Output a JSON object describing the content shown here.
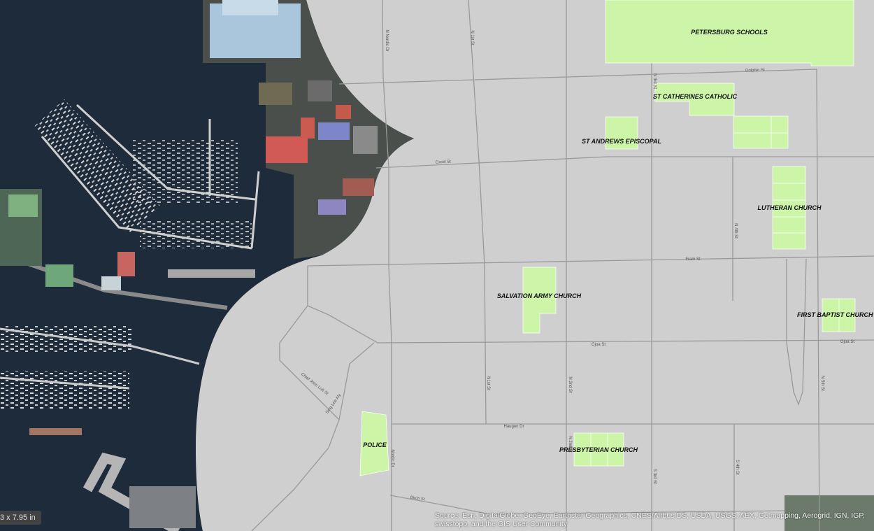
{
  "map": {
    "places": [
      {
        "id": "petersburg-schools",
        "label": "PETERSBURG SCHOOLS"
      },
      {
        "id": "st-catherines",
        "label": "ST CATHERINES CATHOLIC"
      },
      {
        "id": "st-andrews",
        "label": "ST ANDREWS EPISCOPAL"
      },
      {
        "id": "lutheran",
        "label": "LUTHERAN CHURCH"
      },
      {
        "id": "salvation-army",
        "label": "SALVATION ARMY CHURCH"
      },
      {
        "id": "first-baptist",
        "label": "FIRST BAPTIST CHURCH"
      },
      {
        "id": "presbyterian",
        "label": "PRESBYTERIAN CHURCH"
      },
      {
        "id": "police",
        "label": "POLICE"
      }
    ],
    "streets": {
      "dolphin": "Dolphin St",
      "excel": "Excel St",
      "fram": "Fram St",
      "gjoa": "Gjoa St",
      "gjoa_east": "Gjoa St",
      "haugen": "Haugen Dr",
      "birch": "Birch St",
      "chief_john_lott": "Chief John Lott St",
      "sing_lee_alley": "Sing Lee Aly",
      "nordic": "Nordic Dr",
      "nordic_north": "N Nordic Dr",
      "n1st_north": "N 1st St",
      "n1st": "N1st St",
      "n2nd": "N 2nd St",
      "n2nd_south": "N 2nd St",
      "n3rd_north": "N 3rd St",
      "s3rd": "S 3rd St",
      "n4th": "N 4th St",
      "s4th": "S 4th St",
      "n5th": "N 5th St"
    },
    "attribution": "Source: Esri, DigitalGlobe, GeoEye, Earthstar Geographics, CNES/Airbus DS, USDA, USGS, AEX, Getmapping, Aerogrid, IGN, IGP, swisstopo, and the GIS User Community",
    "scale_text": "3 x 7.95 in",
    "colors": {
      "base": "#cfcfcf",
      "water": "#1e2b3b",
      "parcel": "#ccf5a8",
      "road": "#9a9a9a"
    }
  }
}
